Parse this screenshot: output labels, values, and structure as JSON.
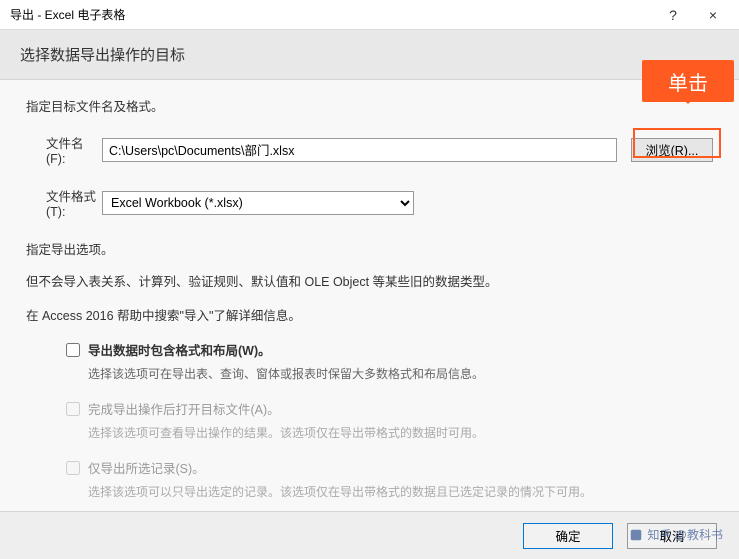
{
  "window": {
    "title": "导出 - Excel 电子表格",
    "help": "?",
    "close": "×"
  },
  "header": "选择数据导出操作的目标",
  "callout": "单击",
  "spec_label": "指定目标文件名及格式。",
  "filename": {
    "label": "文件名(F):",
    "value": "C:\\Users\\pc\\Documents\\部门.xlsx"
  },
  "browse": "浏览(R)...",
  "fileformat": {
    "label": "文件格式(T):",
    "value": "Excel Workbook (*.xlsx)"
  },
  "export_opts_label": "指定导出选项。",
  "note1": "但不会导入表关系、计算列、验证规则、默认值和 OLE Object 等某些旧的数据类型。",
  "note2": "在 Access 2016 帮助中搜索\"导入\"了解详细信息。",
  "opt1": {
    "label": "导出数据时包含格式和布局(W)。",
    "desc": "选择该选项可在导出表、查询、窗体或报表时保留大多数格式和布局信息。"
  },
  "opt2": {
    "label": "完成导出操作后打开目标文件(A)。",
    "desc": "选择该选项可查看导出操作的结果。该选项仅在导出带格式的数据时可用。"
  },
  "opt3": {
    "label": "仅导出所选记录(S)。",
    "desc": "选择该选项可以只导出选定的记录。该选项仅在导出带格式的数据且已选定记录的情况下可用。"
  },
  "buttons": {
    "ok": "确定",
    "cancel": "取消"
  },
  "watermark": "知乎 @教科书"
}
